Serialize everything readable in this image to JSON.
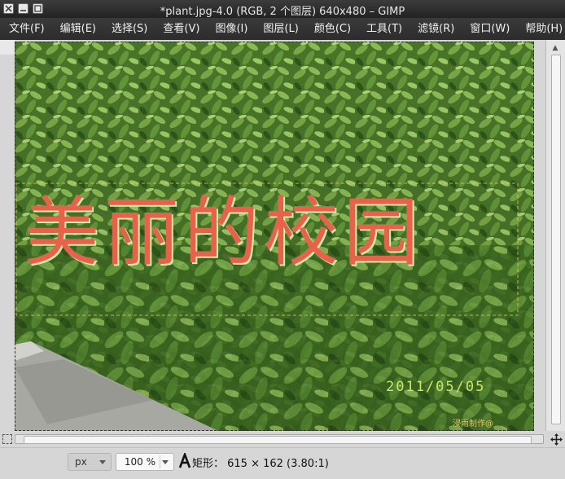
{
  "window": {
    "title": "*plant.jpg-4.0 (RGB, 2 个图层) 640x480 – GIMP"
  },
  "menubar": {
    "items": [
      "文件(F)",
      "编辑(E)",
      "选择(S)",
      "查看(V)",
      "图像(I)",
      "图层(L)",
      "颜色(C)",
      "工具(T)",
      "滤镜(R)",
      "窗口(W)",
      "帮助(H)"
    ]
  },
  "canvas": {
    "headline_text": "美丽的校园",
    "date_stamp": "2011/05/05",
    "watermark": "浸雨制作@"
  },
  "statusbar": {
    "unit": "px",
    "zoom": "100 %",
    "message": "矩形： 615 × 162  (3.80:1)"
  },
  "colors": {
    "title_bg": "#2a2a2a",
    "menubar_bg": "#323232",
    "menu_text": "#f0f0f0",
    "headline_fill": "#e8624a",
    "date_stamp": "#c9e86a"
  },
  "icons": [
    "close-icon",
    "minimize-icon",
    "maximize-icon",
    "text-tool-icon",
    "navigate-icon",
    "zoom-fit-icon",
    "quick-mask-icon"
  ]
}
